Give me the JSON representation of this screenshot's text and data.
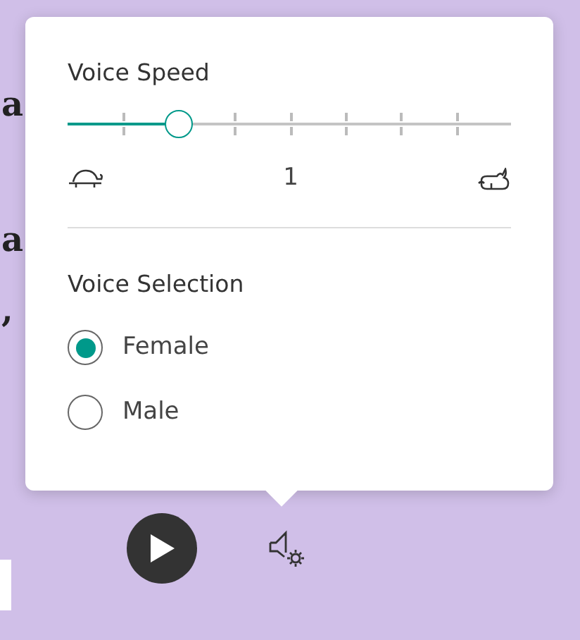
{
  "background_text": [
    "a",
    "a",
    ","
  ],
  "voice_speed": {
    "title": "Voice Speed",
    "level": 0.25,
    "value": "1"
  },
  "voice_selection": {
    "title": "Voice Selection",
    "options": [
      {
        "label": "Female",
        "selected": true
      },
      {
        "label": "Male",
        "selected": false
      }
    ]
  }
}
